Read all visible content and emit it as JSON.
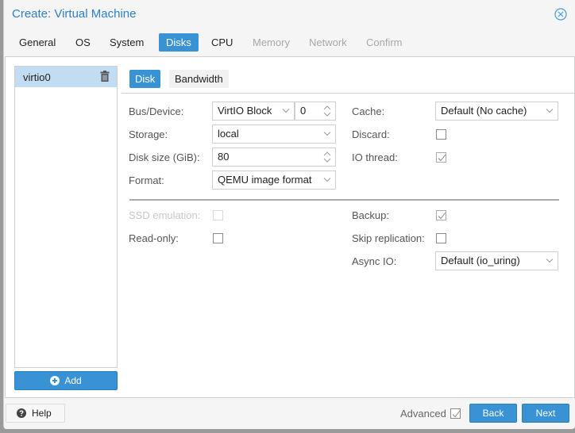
{
  "window": {
    "title": "Create: Virtual Machine"
  },
  "tabs": [
    {
      "label": "General",
      "state": "normal"
    },
    {
      "label": "OS",
      "state": "normal"
    },
    {
      "label": "System",
      "state": "normal"
    },
    {
      "label": "Disks",
      "state": "active"
    },
    {
      "label": "CPU",
      "state": "normal"
    },
    {
      "label": "Memory",
      "state": "disabled"
    },
    {
      "label": "Network",
      "state": "disabled"
    },
    {
      "label": "Confirm",
      "state": "disabled"
    }
  ],
  "disk_list": {
    "items": [
      {
        "label": "virtio0",
        "selected": true
      }
    ],
    "add_label": "Add"
  },
  "subtabs": [
    {
      "label": "Disk",
      "active": true
    },
    {
      "label": "Bandwidth",
      "active": false
    }
  ],
  "form": {
    "bus_device": {
      "label": "Bus/Device:",
      "bus": "VirtIO Block",
      "device": "0"
    },
    "storage": {
      "label": "Storage:",
      "value": "local"
    },
    "disk_size": {
      "label": "Disk size (GiB):",
      "value": "80"
    },
    "format": {
      "label": "Format:",
      "value": "QEMU image format"
    },
    "cache": {
      "label": "Cache:",
      "value": "Default (No cache)"
    },
    "discard": {
      "label": "Discard:",
      "checked": false
    },
    "io_thread": {
      "label": "IO thread:",
      "checked": true
    },
    "ssd_emulation": {
      "label": "SSD emulation:",
      "checked": false,
      "disabled": true
    },
    "read_only": {
      "label": "Read-only:",
      "checked": false
    },
    "backup": {
      "label": "Backup:",
      "checked": true
    },
    "skip_replication": {
      "label": "Skip replication:",
      "checked": false
    },
    "async_io": {
      "label": "Async IO:",
      "value": "Default (io_uring)"
    }
  },
  "footer": {
    "help_label": "Help",
    "advanced_label": "Advanced",
    "advanced_checked": true,
    "back_label": "Back",
    "next_label": "Next"
  },
  "colors": {
    "accent": "#3892d4",
    "title": "#2f7fc6",
    "selected_row": "#c2dcf2"
  }
}
